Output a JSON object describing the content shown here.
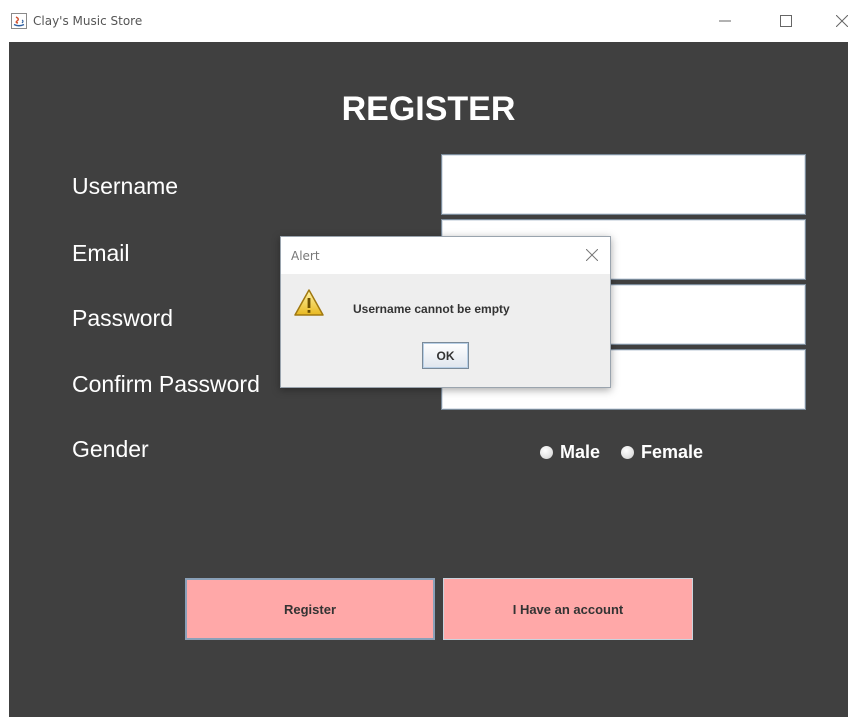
{
  "window": {
    "title": "Clay's Music Store",
    "controls": [
      "minimize",
      "maximize",
      "close"
    ]
  },
  "form": {
    "heading": "REGISTER",
    "fields": [
      {
        "label": "Username",
        "value": ""
      },
      {
        "label": "Email",
        "value": ""
      },
      {
        "label": "Password",
        "value": ""
      },
      {
        "label": "Confirm Password",
        "value": ""
      }
    ],
    "gender": {
      "label": "Gender",
      "options": [
        "Male",
        "Female"
      ]
    },
    "buttons": {
      "register": "Register",
      "have_account": "I Have an account"
    }
  },
  "dialog": {
    "title": "Alert",
    "message": "Username cannot be empty",
    "ok_label": "OK",
    "icon": "warning-icon"
  },
  "colors": {
    "background": "#404040",
    "button": "#ffa8a8",
    "text": "#ffffff"
  }
}
